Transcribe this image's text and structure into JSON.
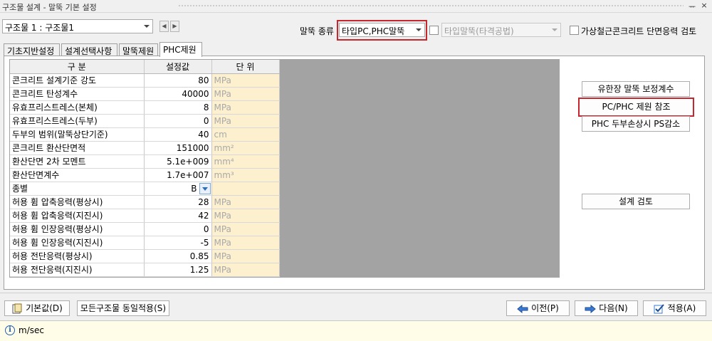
{
  "window": {
    "title": "구조물 설계 - 말뚝 기본 설정",
    "pin_glyph": "ᅲ",
    "close_glyph": "×"
  },
  "structure_select": {
    "value": "구조물 1 : 구조물1"
  },
  "nav": {
    "prev": "◀",
    "next": "▶"
  },
  "pile_type": {
    "label": "말뚝 종류",
    "value": "타입PC,PHC말뚝",
    "secondary_value": "타입말뚝(타격공법)",
    "checkbox_label": "가상철근콘크리트 단면응력 검토"
  },
  "tabs": [
    {
      "label": "기초지반설정"
    },
    {
      "label": "설계선택사항"
    },
    {
      "label": "말뚝제원"
    },
    {
      "label": "PHC제원"
    }
  ],
  "grid": {
    "headers": {
      "name": "구 분",
      "value": "설정값",
      "unit": "단 위"
    },
    "rows": [
      {
        "name": "콘크리트 설계기준 강도",
        "value": "80",
        "unit": "MPa"
      },
      {
        "name": "콘크리트 탄성계수",
        "value": "40000",
        "unit": "MPa"
      },
      {
        "name": "유효프리스트레스(본체)",
        "value": "8",
        "unit": "MPa"
      },
      {
        "name": "유효프리스트레스(두부)",
        "value": "0",
        "unit": "MPa"
      },
      {
        "name": "두부의 범위(말뚝상단기준)",
        "value": "40",
        "unit": "cm"
      },
      {
        "name": "콘크리트 환산단면적",
        "value": "151000",
        "unit": "mm²"
      },
      {
        "name": "환산단면 2차 모멘트",
        "value": "5.1e+009",
        "unit": "mm⁴"
      },
      {
        "name": "환산단면계수",
        "value": "1.7e+007",
        "unit": "mm³"
      },
      {
        "name": "종별",
        "value": "B",
        "unit": "",
        "dropdown": true
      },
      {
        "name": "허용 휨 압축응력(평상시)",
        "value": "28",
        "unit": "MPa"
      },
      {
        "name": "허용 휨 압축응력(지진시)",
        "value": "42",
        "unit": "MPa"
      },
      {
        "name": "허용 휨 인장응력(평상시)",
        "value": "0",
        "unit": "MPa"
      },
      {
        "name": "허용 휨 인장응력(지진시)",
        "value": "-5",
        "unit": "MPa"
      },
      {
        "name": "허용 전단응력(평상시)",
        "value": "0.85",
        "unit": "MPa"
      },
      {
        "name": "허용 전단응력(지진시)",
        "value": "1.25",
        "unit": "MPa"
      }
    ]
  },
  "side_buttons": {
    "correction": "유한장 말뚝 보정계수",
    "phc_ref": "PC/PHC 제원 참조",
    "ps_reduction": "PHC 두부손상시 PS감소",
    "design_check": "설계 검토"
  },
  "bottom_buttons": {
    "default": "기본값(D)",
    "apply_all": "모든구조물 동일적용(S)",
    "prev": "이전(P)",
    "next": "다음(N)",
    "apply": "적용(A)"
  },
  "status": {
    "message": "m/sec"
  },
  "colors": {
    "highlight": "#c6262e",
    "unit_bg": "#fdf0cf",
    "grid_bg": "#a3a3a3",
    "status_bg": "#fffde8"
  }
}
